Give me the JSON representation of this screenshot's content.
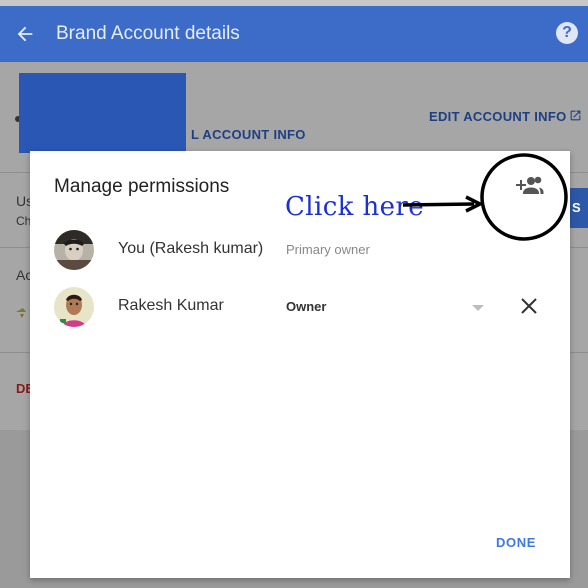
{
  "appbar": {
    "title": "Brand Account details",
    "back_icon": "arrow-back-icon",
    "help_icon": "help-icon",
    "help_glyph": "?"
  },
  "background": {
    "edit_account_info": "EDIT ACCOUNT INFO",
    "account_info_fragment": "L ACCOUNT INFO",
    "users_fragment_1": "Us",
    "users_fragment_2": "Ch",
    "access_fragment": "Ac",
    "delete_fragment": "DE",
    "button_fragment": "S"
  },
  "dialog": {
    "title": "Manage permissions",
    "add_person_icon": "person-add-icon",
    "users": [
      {
        "name": "You (Rakesh kumar)",
        "role": "Primary owner"
      },
      {
        "name": "Rakesh Kumar",
        "role": "Owner"
      }
    ],
    "done_label": "DONE"
  },
  "annotation": {
    "text": "Click here"
  },
  "colors": {
    "appbar": "#3c6cc8",
    "annotation": "#1a2fd6",
    "done": "#3f78e0"
  }
}
